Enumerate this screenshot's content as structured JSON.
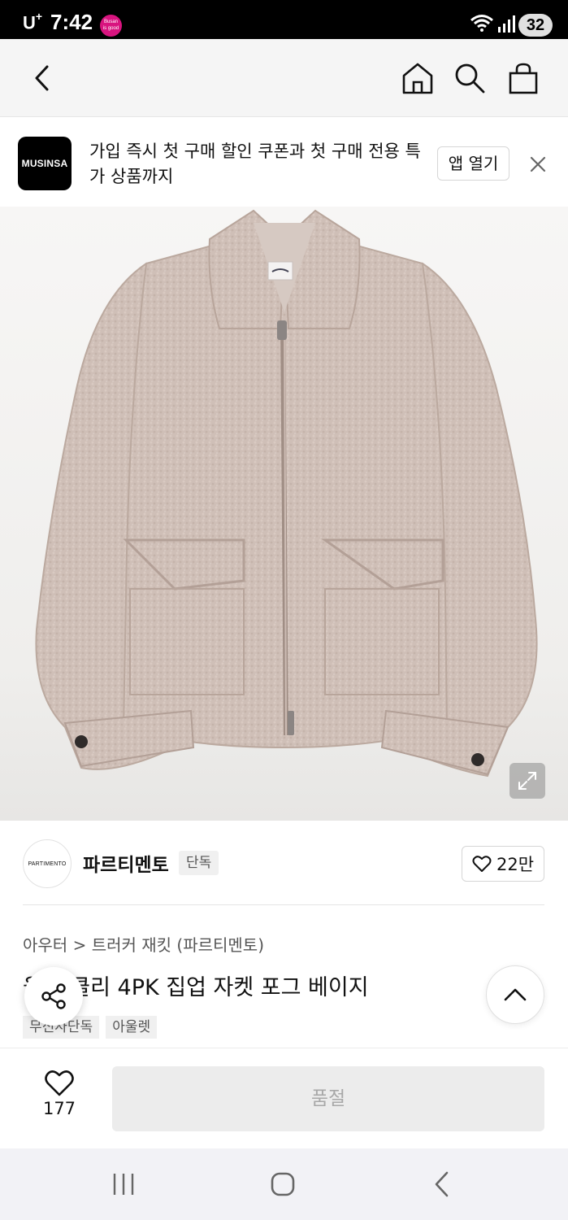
{
  "status_bar": {
    "carrier": "U",
    "carrier_plus": "+",
    "time": "7:42",
    "badge_top": "Busan",
    "badge_bottom": "is good",
    "battery": "32"
  },
  "banner": {
    "logo_text": "MUSINSA",
    "message": "가입 즉시 첫 구매 할인 쿠폰과 첫 구매 전용 특가 상품까지",
    "open_app_label": "앱 열기"
  },
  "brand": {
    "logo_text": "PARTIMENTO",
    "name": "파르티멘토",
    "exclusive_label": "단독",
    "like_count": "22만"
  },
  "product": {
    "breadcrumb_category": "아우터",
    "breadcrumb_separator": ">",
    "breadcrumb_subcategory": "트러커 재킷 (파르티멘토)",
    "title": "울 부클리 4PK 집업 자켓 포그 베이지",
    "tags": [
      "무신사단독",
      "아울렛"
    ]
  },
  "action_bar": {
    "wish_count": "177",
    "sold_out_label": "품절"
  },
  "colors": {
    "accent_black": "#000000",
    "jacket_color": "#cdbcb4",
    "sold_out_bg": "#ececec"
  },
  "icons": {
    "back": "chevron-left-icon",
    "home": "home-icon",
    "search": "search-icon",
    "bag": "shopping-bag-icon",
    "close": "close-icon",
    "zoom": "expand-icon",
    "heart": "heart-icon",
    "share": "share-icon",
    "scroll_top": "chevron-up-icon"
  }
}
